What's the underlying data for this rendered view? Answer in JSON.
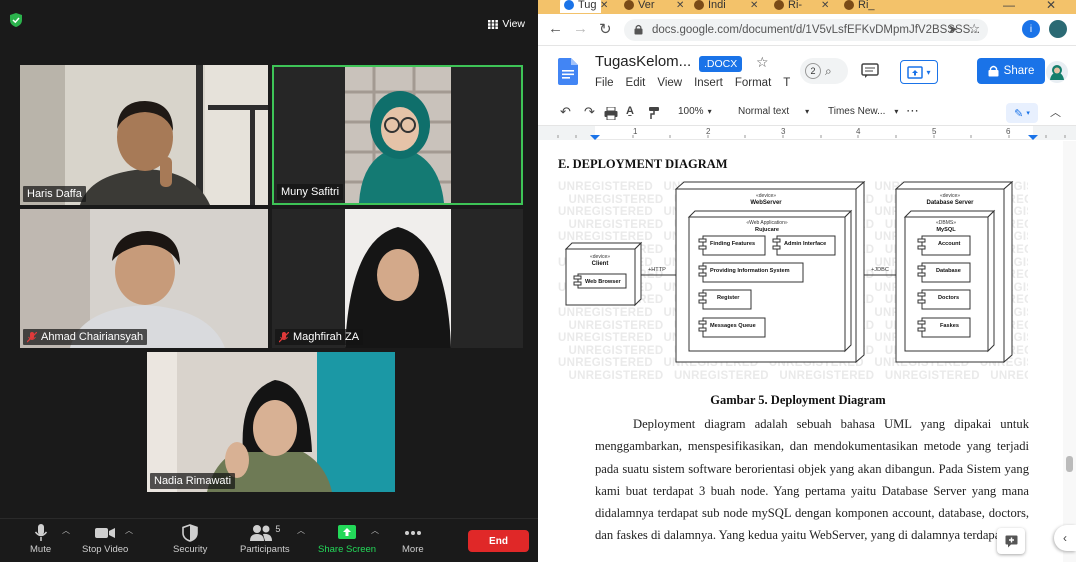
{
  "zoom": {
    "view_label": "View",
    "participants": [
      {
        "name": "Haris Daffa",
        "muted": false,
        "active": false
      },
      {
        "name": "Muny Safitri",
        "muted": false,
        "active": true
      },
      {
        "name": "Ahmad Chairiansyah",
        "muted": true,
        "active": false
      },
      {
        "name": "Maghfirah ZA",
        "muted": true,
        "active": false
      },
      {
        "name": "Nadia Rimawati",
        "muted": false,
        "active": false
      }
    ],
    "toolbar": {
      "mute": "Mute",
      "stop_video": "Stop Video",
      "security": "Security",
      "participants": "Participants",
      "participants_count": "5",
      "share_screen": "Share Screen",
      "more": "More",
      "end": "End"
    },
    "colors": {
      "active_border": "#3ec457",
      "share_green": "#23d959",
      "end_red": "#e02828"
    }
  },
  "browser": {
    "tabs": [
      "Tug",
      "Ver",
      "Indi",
      "Ri-",
      "Ri_"
    ],
    "url": "docs.google.com/document/d/1V5vLsfEFKvDMpmJfV2BSSSS...",
    "doc_title": "TugasKelom...",
    "doc_badge": ".DOCX",
    "menus": [
      "File",
      "Edit",
      "View",
      "Insert",
      "Format",
      "T"
    ],
    "comment_count": "2",
    "share_label": "Share",
    "zoom_level": "100%",
    "style_select": "Normal text",
    "font_select": "Times New...",
    "ruler_numbers": [
      "1",
      "2",
      "3",
      "4",
      "5",
      "6"
    ]
  },
  "document": {
    "heading": "E.  DEPLOYMENT DIAGRAM",
    "watermark": "UNREGISTERED",
    "diagram": {
      "client_stereo": "«device»",
      "client_name": "Client",
      "client_component": "Web Browser",
      "http_label": "+HTTP",
      "webserver_stereo": "«device»",
      "webserver_name": "WebServer",
      "app_stereo": "«Web Application»",
      "app_name": "Rujucare",
      "components": [
        "Finding Features",
        "Admin Interface",
        "Providing Information System",
        "Register",
        "Messages Queue"
      ],
      "jdbc_label": "+JDBC",
      "db_stereo": "«device»",
      "db_name": "Database Server",
      "dbms_stereo": "«DBMS»",
      "dbms_name": "MySQL",
      "db_components": [
        "Account",
        "Database",
        "Doctors",
        "Faskes"
      ]
    },
    "caption": "Gambar 5. Deployment Diagram",
    "paragraph": "Deployment diagram adalah sebuah bahasa UML yang dipakai untuk menggambarkan, menspesifikasikan, dan mendokumentasikan metode yang terjadi pada suatu sistem software berorientasi objek yang akan dibangun. Pada Sistem yang kami buat terdapat 3 buah node. Yang pertama yaitu Database Server yang mana didalamnya terdapat sub node mySQL dengan komponen account, database, doctors, dan faskes di dalamnya. Yang kedua yaitu WebServer, yang di dalamnya terdapat sub"
  }
}
